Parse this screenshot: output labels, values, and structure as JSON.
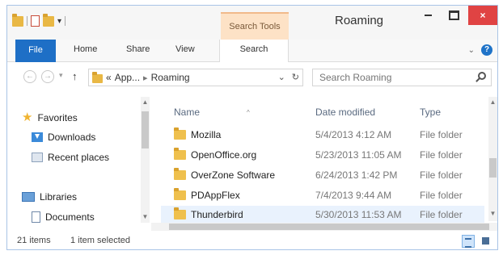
{
  "window": {
    "title": "Roaming",
    "context_tab": "Search Tools",
    "close_glyph": "×"
  },
  "ribbon": {
    "tabs": [
      "File",
      "Home",
      "Share",
      "View",
      "Search"
    ]
  },
  "address": {
    "prefix": "«",
    "crumbs": [
      "App...",
      "Roaming"
    ],
    "separator": "▸",
    "dropdown_glyph": "⌄",
    "refresh_glyph": "↻"
  },
  "search": {
    "placeholder": "Search Roaming"
  },
  "nav_pane": {
    "favorites": "Favorites",
    "downloads": "Downloads",
    "recent_places": "Recent places",
    "libraries": "Libraries",
    "documents": "Documents"
  },
  "columns": {
    "name": "Name",
    "date_modified": "Date modified",
    "type": "Type"
  },
  "rows": [
    {
      "name": "Mozilla",
      "date": "5/4/2013 4:12 AM",
      "type": "File folder"
    },
    {
      "name": "OpenOffice.org",
      "date": "5/23/2013 11:05 AM",
      "type": "File folder"
    },
    {
      "name": "OverZone Software",
      "date": "6/24/2013 1:42 PM",
      "type": "File folder"
    },
    {
      "name": "PDAppFlex",
      "date": "7/4/2013 9:44 AM",
      "type": "File folder"
    },
    {
      "name": "Thunderbird",
      "date": "5/30/2013 11:53 AM",
      "type": "File folder"
    }
  ],
  "status": {
    "item_count": "21 items",
    "selection": "1 item selected"
  },
  "colors": {
    "file_tab": "#1e6fc6",
    "close_button": "#e04343",
    "context_tab": "#fde2c6",
    "selection": "#e9f2fd"
  }
}
